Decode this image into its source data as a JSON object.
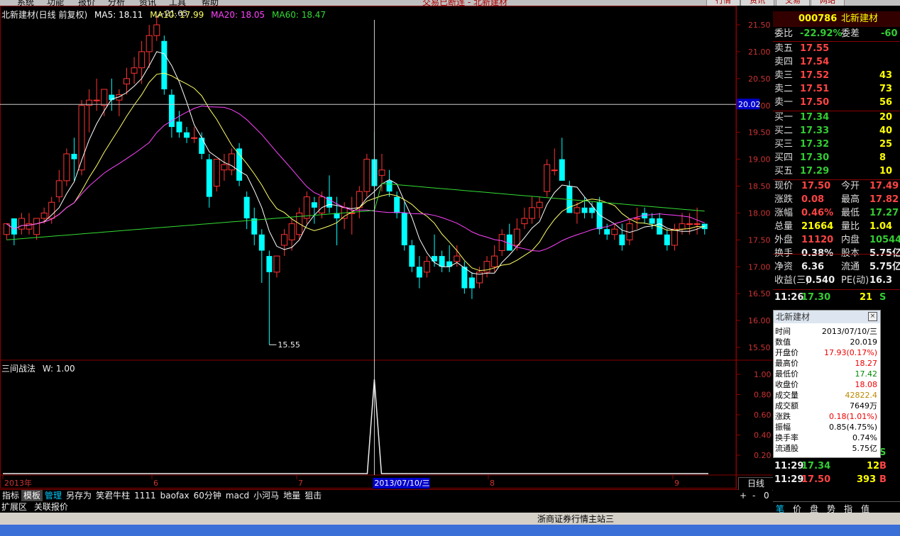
{
  "menu": [
    "系统",
    "功能",
    "报价",
    "分析",
    "资讯",
    "工具",
    "帮助"
  ],
  "window_title_fragment": "交易已断连 - 北新建材",
  "top_buttons": [
    "行情",
    "资讯",
    "交易",
    "网站"
  ],
  "stock_header": {
    "code": "000786",
    "name": "北新建材"
  },
  "chart_title": {
    "name": "北新建材(日线 前复权)",
    "ma5": "MA5: 18.11",
    "ma10": "MA10: 17.99",
    "ma20": "MA20: 18.05",
    "ma60": "MA60: 18.47"
  },
  "annotations": {
    "high": "21.65",
    "low": "15.55",
    "crosshair_price": "20.02",
    "crosshair_date": "2013/07/10/三"
  },
  "month_labels": [
    "2013年",
    "6",
    "7",
    "8",
    "9"
  ],
  "indicator": {
    "title": "三间战法",
    "param": "W: 1.00",
    "ticks": [
      "1.00",
      "0.80",
      "0.60",
      "0.40",
      "0.20"
    ]
  },
  "bottom_tabs": [
    "指标",
    "模板",
    "管理",
    "另存为",
    "笑君牛柱",
    "1111",
    "baofax",
    "60分钟",
    "macd",
    "小河马",
    "地量",
    "狙击"
  ],
  "bottom_tab2": [
    "扩展区",
    "关联报价"
  ],
  "period_label": "日线",
  "status_text": "浙商证券行情主站三",
  "nav_buttons": [
    "+",
    "-",
    "0"
  ],
  "right_tabs": [
    "笔",
    "价",
    "盘",
    "势",
    "指",
    "值"
  ],
  "chart_data": {
    "type": "candlestick",
    "ylim": [
      15.3,
      21.7
    ],
    "y_ticks": [
      "21.50",
      "21.00",
      "20.50",
      "20.00",
      "19.50",
      "19.00",
      "18.50",
      "18.00",
      "17.50",
      "17.00",
      "16.50",
      "16.00",
      "15.50"
    ],
    "candles": [
      [
        17.6,
        17.8,
        17.5,
        17.8
      ],
      [
        17.9,
        17.9,
        17.4,
        17.6
      ],
      [
        17.7,
        18.0,
        17.6,
        17.9
      ],
      [
        17.7,
        18.0,
        17.6,
        17.8
      ],
      [
        17.6,
        17.9,
        17.5,
        17.9
      ],
      [
        17.9,
        18.1,
        17.8,
        18.0
      ],
      [
        17.9,
        18.3,
        17.8,
        18.2
      ],
      [
        18.3,
        18.8,
        18.2,
        18.6
      ],
      [
        18.6,
        19.2,
        18.5,
        19.1
      ],
      [
        19.1,
        19.4,
        18.6,
        19.0
      ],
      [
        18.8,
        20.1,
        18.7,
        20.0
      ],
      [
        20.0,
        20.3,
        19.5,
        20.1
      ],
      [
        20.1,
        20.5,
        19.9,
        20.1
      ],
      [
        20.0,
        20.3,
        19.8,
        20.3
      ],
      [
        20.2,
        20.5,
        19.9,
        20.1
      ],
      [
        20.1,
        20.3,
        19.8,
        20.2
      ],
      [
        20.4,
        20.7,
        20.2,
        20.5
      ],
      [
        20.6,
        20.9,
        20.4,
        20.7
      ],
      [
        20.7,
        21.2,
        20.4,
        21.0
      ],
      [
        21.0,
        21.5,
        20.7,
        21.3
      ],
      [
        21.3,
        21.65,
        21.2,
        21.5
      ],
      [
        21.2,
        21.3,
        20.2,
        20.3
      ],
      [
        20.2,
        20.3,
        19.4,
        19.6
      ],
      [
        19.7,
        19.9,
        19.4,
        19.5
      ],
      [
        19.5,
        19.6,
        19.3,
        19.4
      ],
      [
        19.4,
        19.6,
        19.3,
        19.4
      ],
      [
        19.4,
        19.5,
        19.0,
        19.1
      ],
      [
        19.0,
        19.1,
        18.1,
        18.3
      ],
      [
        18.5,
        19.0,
        18.4,
        19.0
      ],
      [
        18.8,
        19.1,
        18.6,
        18.9
      ],
      [
        18.8,
        19.2,
        18.7,
        19.1
      ],
      [
        19.2,
        19.3,
        18.5,
        18.6
      ],
      [
        18.3,
        18.4,
        17.7,
        17.9
      ],
      [
        17.9,
        18.1,
        17.4,
        17.6
      ],
      [
        17.6,
        17.7,
        16.7,
        17.3
      ],
      [
        17.2,
        17.3,
        15.55,
        16.9
      ],
      [
        16.9,
        17.2,
        16.8,
        17.2
      ],
      [
        17.4,
        17.7,
        17.2,
        17.6
      ],
      [
        17.5,
        17.9,
        17.3,
        17.8
      ],
      [
        17.6,
        18.1,
        17.5,
        18.0
      ],
      [
        17.9,
        18.4,
        17.8,
        18.3
      ],
      [
        18.2,
        18.3,
        17.8,
        18.1
      ],
      [
        18.0,
        18.4,
        17.9,
        18.3
      ],
      [
        18.3,
        18.7,
        18.0,
        18.1
      ],
      [
        18.0,
        18.3,
        17.4,
        17.9
      ],
      [
        17.9,
        18.2,
        17.7,
        18.1
      ],
      [
        18.0,
        18.3,
        17.6,
        18.0
      ],
      [
        18.1,
        18.5,
        17.9,
        18.4
      ],
      [
        18.4,
        19.1,
        18.3,
        19.0
      ],
      [
        19.0,
        19.5,
        18.3,
        18.5
      ],
      [
        18.7,
        19.1,
        18.4,
        18.8
      ],
      [
        18.6,
        18.8,
        18.3,
        18.4
      ],
      [
        18.3,
        18.4,
        17.9,
        18.0
      ],
      [
        18.0,
        18.2,
        17.3,
        17.4
      ],
      [
        17.4,
        17.5,
        16.9,
        17.0
      ],
      [
        17.0,
        17.2,
        16.6,
        16.8
      ],
      [
        16.9,
        17.2,
        16.8,
        17.1
      ],
      [
        17.2,
        17.6,
        17.0,
        17.1
      ],
      [
        17.2,
        17.3,
        16.9,
        17.0
      ],
      [
        17.1,
        17.4,
        16.9,
        17.0
      ],
      [
        17.1,
        17.4,
        17.0,
        17.2
      ],
      [
        17.0,
        17.1,
        16.5,
        16.6
      ],
      [
        16.8,
        16.9,
        16.4,
        16.6
      ],
      [
        16.7,
        17.0,
        16.6,
        16.9
      ],
      [
        16.9,
        17.2,
        16.8,
        17.1
      ],
      [
        17.0,
        17.4,
        16.9,
        17.2
      ],
      [
        17.3,
        17.7,
        17.2,
        17.6
      ],
      [
        17.6,
        17.8,
        17.3,
        17.3
      ],
      [
        17.4,
        17.9,
        17.3,
        17.7
      ],
      [
        17.8,
        18.1,
        17.7,
        17.9
      ],
      [
        17.9,
        18.3,
        17.8,
        18.1
      ],
      [
        18.1,
        18.3,
        17.9,
        18.2
      ],
      [
        18.4,
        19.0,
        18.3,
        18.9
      ],
      [
        18.8,
        19.2,
        18.7,
        18.8
      ],
      [
        19.0,
        19.4,
        18.7,
        18.6
      ],
      [
        18.5,
        18.6,
        18.0,
        18.0
      ],
      [
        18.0,
        18.2,
        17.8,
        18.1
      ],
      [
        18.1,
        18.3,
        17.9,
        18.0
      ],
      [
        18.1,
        18.2,
        17.9,
        18.0
      ],
      [
        18.2,
        18.3,
        17.6,
        17.7
      ],
      [
        17.7,
        17.8,
        17.5,
        17.6
      ],
      [
        17.6,
        17.8,
        17.5,
        17.7
      ],
      [
        17.6,
        17.8,
        17.3,
        17.4
      ],
      [
        17.5,
        17.9,
        17.4,
        17.8
      ],
      [
        17.9,
        18.1,
        17.7,
        17.9
      ],
      [
        18.0,
        18.1,
        17.8,
        17.9
      ],
      [
        17.9,
        18.0,
        17.7,
        17.8
      ],
      [
        17.9,
        18.0,
        17.6,
        17.6
      ],
      [
        17.6,
        17.7,
        17.3,
        17.4
      ],
      [
        17.4,
        17.8,
        17.3,
        17.7
      ],
      [
        17.7,
        18.0,
        17.6,
        17.8
      ],
      [
        17.8,
        18.0,
        17.6,
        17.8
      ],
      [
        17.8,
        18.1,
        17.6,
        17.8
      ],
      [
        17.8,
        17.8,
        17.6,
        17.7
      ]
    ],
    "ma_lines": [
      {
        "name": "MA5",
        "color": "#ffffff"
      },
      {
        "name": "MA10",
        "color": "#ffff66"
      },
      {
        "name": "MA20",
        "color": "#ff44ff"
      },
      {
        "name": "MA60",
        "color": "#33dd33"
      }
    ],
    "indicator_signal_index": 49
  },
  "quote": {
    "weibi": {
      "label": "委比",
      "value": "-22.92%",
      "label2": "委差",
      "value2": "-60"
    },
    "sells": [
      {
        "label": "卖五",
        "price": "17.55",
        "vol": ""
      },
      {
        "label": "卖四",
        "price": "17.54",
        "vol": ""
      },
      {
        "label": "卖三",
        "price": "17.52",
        "vol": "43"
      },
      {
        "label": "卖二",
        "price": "17.51",
        "vol": "73"
      },
      {
        "label": "卖一",
        "price": "17.50",
        "vol": "56"
      }
    ],
    "buys": [
      {
        "label": "买一",
        "price": "17.34",
        "vol": "20"
      },
      {
        "label": "买二",
        "price": "17.33",
        "vol": "40"
      },
      {
        "label": "买三",
        "price": "17.32",
        "vol": "25"
      },
      {
        "label": "买四",
        "price": "17.30",
        "vol": "8"
      },
      {
        "label": "买五",
        "price": "17.29",
        "vol": "10"
      }
    ],
    "stats": [
      {
        "l1": "现价",
        "v1": "17.50",
        "c1": "red",
        "l2": "今开",
        "v2": "17.49",
        "c2": "red"
      },
      {
        "l1": "涨跌",
        "v1": "0.08",
        "c1": "red",
        "l2": "最高",
        "v2": "17.82",
        "c2": "red"
      },
      {
        "l1": "涨幅",
        "v1": "0.46%",
        "c1": "red",
        "l2": "最低",
        "v2": "17.27",
        "c2": "green"
      },
      {
        "l1": "总量",
        "v1": "21664",
        "c1": "yellow",
        "l2": "量比",
        "v2": "1.04",
        "c2": "yellow"
      },
      {
        "l1": "外盘",
        "v1": "11120",
        "c1": "red",
        "l2": "内盘",
        "v2": "10544",
        "c2": "green"
      },
      {
        "l1": "换手",
        "v1": "0.38%",
        "c1": "white",
        "l2": "股本",
        "v2": "5.75亿",
        "c2": "white"
      },
      {
        "l1": "净资",
        "v1": "6.36",
        "c1": "white",
        "l2": "流通",
        "v2": "5.75亿",
        "c2": "white"
      },
      {
        "l1": "收益(三)",
        "v1": "0.540",
        "c1": "white",
        "l2": "PE(动)",
        "v2": "16.3",
        "c2": "white"
      }
    ],
    "ticks": [
      {
        "time": "11:26",
        "price": "17.30",
        "vol": "21",
        "bs": "S"
      },
      {
        "time": "11:29",
        "price": "17.33",
        "vol": "9",
        "bs": "S"
      },
      {
        "time": "11:29",
        "price": "17.34",
        "vol": "12",
        "bs": "B"
      },
      {
        "time": "11:29",
        "price": "17.50",
        "vol": "393",
        "bs": "B"
      }
    ]
  },
  "popup": {
    "title": "北新建材",
    "rows": [
      {
        "k": "时间",
        "v": "2013/07/10/三",
        "c": "#000"
      },
      {
        "k": "数值",
        "v": "20.019",
        "c": "#000"
      },
      {
        "k": "开盘价",
        "v": "17.93(0.17%)",
        "c": "#e00"
      },
      {
        "k": "最高价",
        "v": "18.27",
        "c": "#e00"
      },
      {
        "k": "最低价",
        "v": "17.42",
        "c": "#080"
      },
      {
        "k": "收盘价",
        "v": "18.08",
        "c": "#e00"
      },
      {
        "k": "成交量",
        "v": "42822.4",
        "c": "#b80"
      },
      {
        "k": "成交额",
        "v": "7649万",
        "c": "#000"
      },
      {
        "k": "涨跌",
        "v": "0.18(1.01%)",
        "c": "#e00"
      },
      {
        "k": "振幅",
        "v": "0.85(4.75%)",
        "c": "#000"
      },
      {
        "k": "换手率",
        "v": "0.74%",
        "c": "#000"
      },
      {
        "k": "流通股",
        "v": "5.75亿",
        "c": "#000"
      }
    ]
  }
}
